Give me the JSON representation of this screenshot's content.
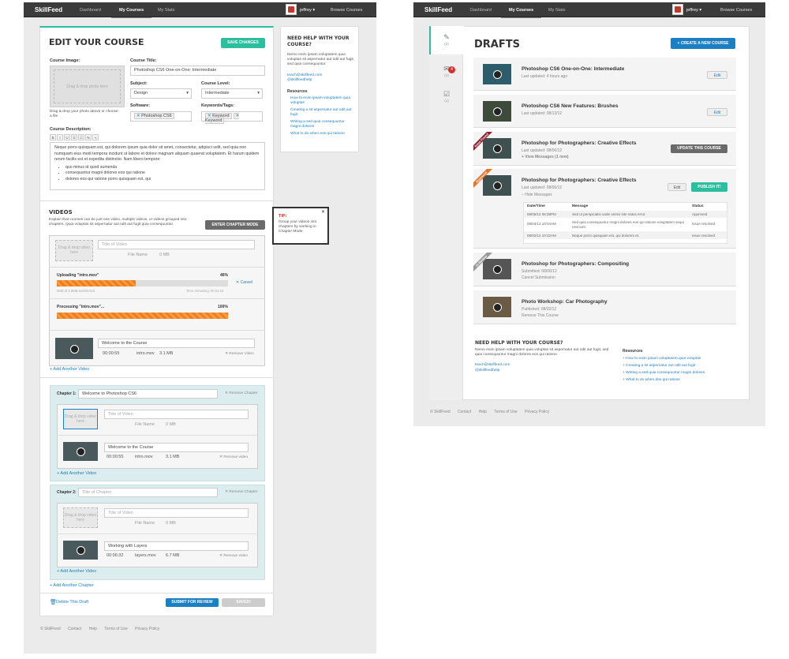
{
  "nav": {
    "logo": "SkillFeed",
    "dashboard": "Dashboard",
    "my_courses": "My Courses",
    "my_stats": "My Stats",
    "user": "jeffrey ▾",
    "browse": "Browse Courses"
  },
  "edit": {
    "title": "EDIT YOUR COURSE",
    "save": "SAVE CHANGES",
    "course_image": "Course Image:",
    "drop_photo": "Drag & drop photo here",
    "drop_help": "Drag & drop your photo above or choose a file",
    "course_title_label": "Course Title:",
    "course_title": "Photoshop CS6 One-on-One: Intermediate",
    "subject_label": "Subject:",
    "subject": "Design",
    "level_label": "Course Level:",
    "level": "Intermediate",
    "software_label": "Software:",
    "software_tag": "Photoshop CS6",
    "keywords_label": "Keywords/Tags:",
    "keyword1": "Keyword",
    "keyword2": "Keyword",
    "desc_label": "Course Description:",
    "desc_text": "Neque porro quisquam est, qui dolorem ipsum quia dolor sit amet, consectetur, adipisci velit, sed quia non numquam eius modi tempora incidunt ut labore et dolore magnam aliquam quaerat voluptatem. Et harum quidem rerum facilis est et expedita distinctio. Nam libero tempore:",
    "bullets": [
      "quo minus id quod sumenda",
      "consequuntur magni dolores eos qui ratione",
      "dolores eos qui ratione porro quisquam est, qui"
    ],
    "toolbar": [
      "B",
      "I",
      "U",
      "☰",
      "☷",
      "%",
      "⤷"
    ]
  },
  "help": {
    "title": "NEED HELP WITH YOUR COURSE?",
    "body": "Nemo enim ipsam voluptatem quia voluptas sit aspernatur aut odit aut fugit, sed quia consequuntur.",
    "email": "teach@skillfeed.com",
    "twitter": "@skillfeedhelp",
    "res_label": "Resources",
    "res": [
      "How to enim ipsam voluptatem quia voluptas",
      "Creating a sit aspernatur aut odit aut fugit",
      "Writing a sed quia consequuntur magni dolores",
      "What to do when eos qui ratione"
    ]
  },
  "videos": {
    "title": "VIDEOS",
    "intro": "Explain that courses can be just one video, multiple videos, or videos grouped into chapters. Quia voluptas sit aspernatur aut odit aut fugit quia consequuntur.",
    "chapter_mode": "ENTER CHAPTER MODE",
    "tip_title": "TIP:",
    "tip_body": "Group your videos into chapters by working in Chapter Mode.",
    "drop": "Drag & drop video here",
    "title_ph": "Title of Video",
    "file_name": "File Name",
    "zero_mb": "0 MB",
    "uploading": "Uploading \"intro.mov\"",
    "up_pct": "46%",
    "up_frac": 0.46,
    "cancel": "✕ Cancel",
    "transferred": "5MB of 3.8MB transferred",
    "remaining": "Time remaining: 00:01:15",
    "processing": "Processing \"intro.mov\"...",
    "proc_pct": "100%",
    "proc_frac": 1.0,
    "video1": "Welcome to the Course",
    "v1_dur": "00:00:55",
    "v1_file": "intro.mov",
    "v1_size": "3.1 MB",
    "remove": "✕ Remove Video",
    "add": "+ Add Another Video",
    "ch1_label": "Chapter 1:",
    "ch1_title": "Welcome to Photoshop CS6",
    "remove_ch": "✕ Remove Chapter",
    "ch1_video": "Welcome to the Course",
    "ch1_dur": "00:00:55",
    "ch1_file": "intro.mov",
    "ch1_size": "3.1 MB",
    "remove_lc": "✕ Remove video",
    "ch2_label": "Chapter 2:",
    "ch2_ph": "Title of Chapter",
    "ch2_video": "Working with Layers",
    "ch2_dur": "00:06:32",
    "ch2_file": "layers.mov",
    "ch2_size": "6.7 MB",
    "add_chapter": "+ Add Another Chapter",
    "delete": "Delete This Draft",
    "submit": "SUBMIT FOR REVIEW",
    "saved": "SAVED!"
  },
  "footer": {
    "copy": "© SkillFeed",
    "contact": "Contact",
    "help": "Help",
    "terms": "Terms of Use",
    "privacy": "Privacy Policy"
  },
  "drafts": {
    "title": "DRAFTS",
    "create": "+ CREATE A NEW COURSE",
    "side": [
      {
        "icon": "✎",
        "count": "(2)"
      },
      {
        "icon": "✉",
        "count": "(2)"
      },
      {
        "icon": "☑",
        "count": "(1)"
      }
    ],
    "badge": "4",
    "rows": [
      {
        "title": "Photoshop CS6 One-on-One: Intermediate",
        "sub": "Last updated: 4 hours ago",
        "action": "Edit"
      },
      {
        "title": "Photoshop CS6 New Features: Brushes",
        "sub": "Last updated: 08/13/12",
        "action": "Edit"
      },
      {
        "title": "Photoshop for Photographers: Creative Effects",
        "sub": "Last updated: 08/06/12",
        "link": "+ View Messages (1 new)",
        "action": "UPDATE THIS COURSE",
        "ribbon": "Issue Found"
      },
      {
        "title": "Photoshop for Photographers: Creative Effects",
        "sub": "Last updated: 08/06/12",
        "link": "− Hide Messages",
        "action": "Edit",
        "action2": "PUBLISH IT!",
        "ribbon": "Approved"
      },
      {
        "title": "Photoshop for Photographers: Compositing",
        "sub": "Submitted: 08/06/12",
        "link": "Cancel Submission",
        "ribbon": "In Review"
      },
      {
        "title": "Photo Workshop: Car Photography",
        "sub": "Published: 08/02/12",
        "link": "Remove This Course"
      }
    ],
    "msg_head": [
      "Date/Time",
      "Message",
      "Status"
    ],
    "msgs": [
      [
        "08/06/12 06:38PM",
        "Sed ut perspiciatis unde omnis iste natus error.",
        "Approved"
      ],
      [
        "08/04/12 10:04AM",
        "Sed quia consequuntur magni dolores eos qui ratione voluptatem sequi nesciunt.",
        "Issue resolved"
      ],
      [
        "08/02/12 10:32AM",
        "Neque porro quisquam est, qui dolorem et.",
        "Issue resolved"
      ]
    ],
    "help_title": "NEED HELP WITH YOUR COURSE?",
    "help_body": "Nemo enim ipsam voluptatem quia voluptas sit aspernatur aut odit aut fugit, sed quia consequuntur magni dolores eos qui ratione.",
    "res": [
      "+ How to enim ipsam voluptatem quia voluptas",
      "+ Creating a sit aspernatur aut odit aut fugit",
      "+ Writing a sed quia consequuntur magni dolores",
      "+ What to do when dos qui ratione"
    ]
  }
}
